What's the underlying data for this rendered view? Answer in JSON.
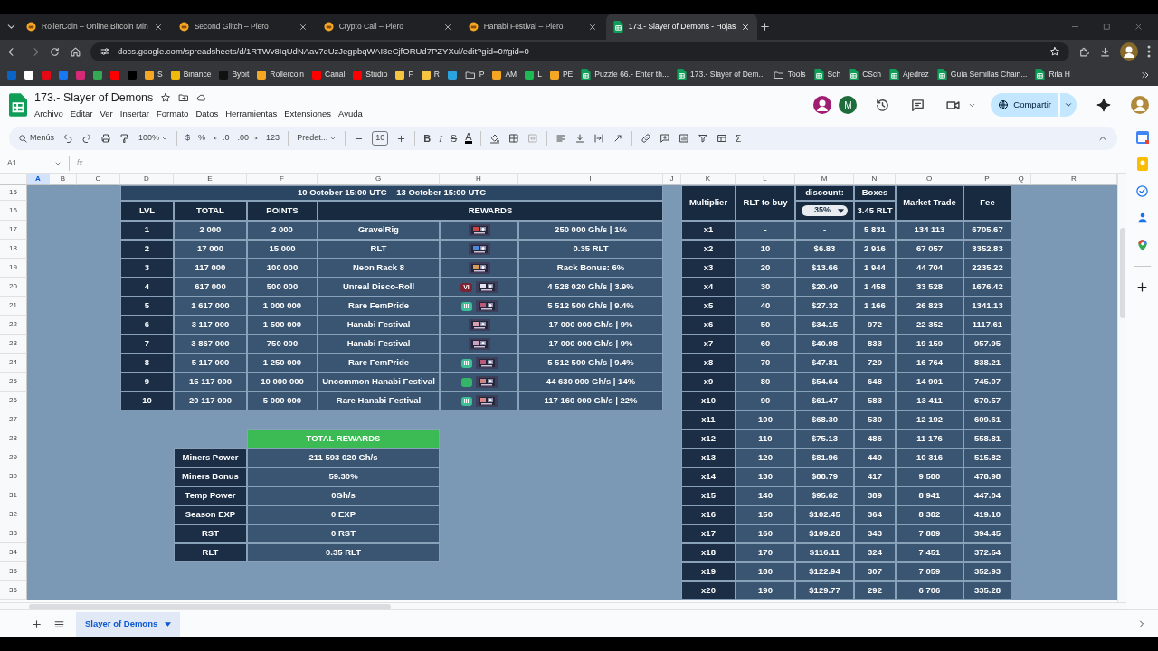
{
  "browser": {
    "tabs": [
      {
        "title": "RollerCoin – Online Bitcoin Min",
        "kind": "site",
        "selected": false
      },
      {
        "title": "Second Glitch – Piero",
        "kind": "site",
        "selected": false
      },
      {
        "title": "Crypto Call – Piero",
        "kind": "site",
        "selected": false
      },
      {
        "title": "Hanabi Festival – Piero",
        "kind": "site",
        "selected": false
      },
      {
        "title": "173.- Slayer of Demons - Hojas",
        "kind": "sheet",
        "selected": true
      }
    ],
    "url": "docs.google.com/spreadsheets/d/1RTWv8IqUdNAav7eUzJegpbqWAI8eCjfORUd7PZYXul/edit?gid=0#gid=0",
    "bookmarks": [
      {
        "kind": "site",
        "color": "#0a64c8"
      },
      {
        "kind": "site",
        "color": "#ffffff"
      },
      {
        "kind": "site",
        "color": "#e50914"
      },
      {
        "kind": "site",
        "color": "#1877f2"
      },
      {
        "kind": "site",
        "color": "#d62976"
      },
      {
        "kind": "site",
        "color": "#34a853"
      },
      {
        "kind": "site",
        "color": "#ff0000"
      },
      {
        "kind": "site",
        "color": "#000000"
      },
      {
        "kind": "site",
        "color": "#f5a623",
        "label": "S"
      },
      {
        "kind": "site",
        "color": "#f0b90b",
        "label": "Binance"
      },
      {
        "kind": "site",
        "color": "#111111",
        "label": "Bybit"
      },
      {
        "kind": "site",
        "color": "#f5a623",
        "label": "Rollercoin"
      },
      {
        "kind": "site",
        "color": "#ff0000",
        "label": "Canal"
      },
      {
        "kind": "site",
        "color": "#ff0000",
        "label": "Studio"
      },
      {
        "kind": "site",
        "color": "#f5c542",
        "label": "F"
      },
      {
        "kind": "site",
        "color": "#f5c542",
        "label": "R"
      },
      {
        "kind": "site",
        "color": "#2aa3df"
      },
      {
        "kind": "folder",
        "label": "P"
      },
      {
        "kind": "site",
        "color": "#f5a623",
        "label": "AM"
      },
      {
        "kind": "site",
        "color": "#1db954",
        "label": "L"
      },
      {
        "kind": "site",
        "color": "#f5a623",
        "label": "PE"
      },
      {
        "kind": "sheet",
        "label": "Puzzle 66.- Enter th..."
      },
      {
        "kind": "sheet",
        "label": "173.- Slayer of Dem..."
      },
      {
        "kind": "folder",
        "label": "Tools"
      },
      {
        "kind": "sheet",
        "label": "Sch"
      },
      {
        "kind": "sheet",
        "label": "CSch"
      },
      {
        "kind": "sheet",
        "label": "Ajedrez"
      },
      {
        "kind": "sheet",
        "label": "Guía Semillas Chain..."
      },
      {
        "kind": "sheet",
        "label": "Rifa H"
      }
    ]
  },
  "sheets": {
    "title": "173.- Slayer of Demons",
    "menus": [
      "Archivo",
      "Editar",
      "Ver",
      "Insertar",
      "Formato",
      "Datos",
      "Herramientas",
      "Extensiones",
      "Ayuda"
    ],
    "avatar": "M",
    "share": "Compartir",
    "search_placeholder": "Menús",
    "zoom": "100%",
    "number_formats": [
      "$",
      "%",
      ".0",
      ".00",
      "123"
    ],
    "font": "Predet...",
    "font_size": "10",
    "styles": [
      {
        "text": "B",
        "kind": "bold"
      },
      {
        "text": "I",
        "kind": "italic"
      },
      {
        "text": "S",
        "kind": "strike"
      },
      {
        "text": "A",
        "kind": "color"
      }
    ],
    "functions": "Σ",
    "cell_ref": "A1",
    "fx": "fx"
  },
  "columns": [
    "A",
    "B",
    "C",
    "D",
    "E",
    "F",
    "G",
    "H",
    "I",
    "J",
    "K",
    "L",
    "M",
    "N",
    "O",
    "P",
    "Q",
    "R"
  ],
  "row_numbers": [
    "15",
    "16",
    "17",
    "18",
    "19",
    "20",
    "21",
    "22",
    "23",
    "24",
    "25",
    "26",
    "27",
    "28",
    "29",
    "30",
    "31",
    "32",
    "33",
    "34",
    "35",
    "36"
  ],
  "event": {
    "banner": "10 October 15:00 UTC – 13 October 15:00 UTC",
    "headers": [
      "LVL",
      "TOTAL",
      "POINTS",
      "REWARDS"
    ],
    "levels": [
      {
        "lvl": "1",
        "total": "2 000",
        "points": "2 000",
        "name": "GravelRig",
        "reward": "250 000 Gh/s | 1%"
      },
      {
        "lvl": "2",
        "total": "17 000",
        "points": "15 000",
        "name": "RLT",
        "reward": "0.35 RLT"
      },
      {
        "lvl": "3",
        "total": "117 000",
        "points": "100 000",
        "name": "Neon Rack 8",
        "reward": "Rack Bonus: 6%"
      },
      {
        "lvl": "4",
        "total": "617 000",
        "points": "500 000",
        "name": "Unreal Disco-Roll",
        "badge": {
          "text": "VI",
          "color": "#7a2433"
        },
        "reward": "4 528 020 Gh/s | 3.9%"
      },
      {
        "lvl": "5",
        "total": "1 617 000",
        "points": "1 000 000",
        "name": "Rare FemPride",
        "badge": {
          "text": "III",
          "color": "#3fbf95"
        },
        "reward": "5 512 500 Gh/s | 9.4%"
      },
      {
        "lvl": "6",
        "total": "3 117 000",
        "points": "1 500 000",
        "name": "Hanabi Festival",
        "reward": "17 000 000 Gh/s | 9%"
      },
      {
        "lvl": "7",
        "total": "3 867 000",
        "points": "750 000",
        "name": "Hanabi Festival",
        "reward": "17 000 000 Gh/s | 9%"
      },
      {
        "lvl": "8",
        "total": "5 117 000",
        "points": "1 250 000",
        "name": "Rare FemPride",
        "badge": {
          "text": "III",
          "color": "#3fbf95"
        },
        "reward": "5 512 500 Gh/s | 9.4%"
      },
      {
        "lvl": "9",
        "total": "15 117 000",
        "points": "10 000 000",
        "name": "Uncommon Hanabi Festival",
        "badge": {
          "color": "#35b56a"
        },
        "reward": "44 630 000 Gh/s | 14%"
      },
      {
        "lvl": "10",
        "total": "20 117 000",
        "points": "5 000 000",
        "name": "Rare Hanabi Festival",
        "badge": {
          "text": "III",
          "color": "#3fbf95"
        },
        "reward": "117 160 000 Gh/s | 22%"
      }
    ]
  },
  "multiplier_table": {
    "headers": [
      "Multiplier",
      "RLT to buy",
      "discount:",
      "Boxes",
      "Market Trade",
      "Fee"
    ],
    "discount": "35%",
    "box_price": "3.45 RLT",
    "rows": [
      [
        "x1",
        "-",
        "-",
        "5 831",
        "134 113",
        "6705.67"
      ],
      [
        "x2",
        "10",
        "$6.83",
        "2 916",
        "67 057",
        "3352.83"
      ],
      [
        "x3",
        "20",
        "$13.66",
        "1 944",
        "44 704",
        "2235.22"
      ],
      [
        "x4",
        "30",
        "$20.49",
        "1 458",
        "33 528",
        "1676.42"
      ],
      [
        "x5",
        "40",
        "$27.32",
        "1 166",
        "26 823",
        "1341.13"
      ],
      [
        "x6",
        "50",
        "$34.15",
        "972",
        "22 352",
        "1117.61"
      ],
      [
        "x7",
        "60",
        "$40.98",
        "833",
        "19 159",
        "957.95"
      ],
      [
        "x8",
        "70",
        "$47.81",
        "729",
        "16 764",
        "838.21"
      ],
      [
        "x9",
        "80",
        "$54.64",
        "648",
        "14 901",
        "745.07"
      ],
      [
        "x10",
        "90",
        "$61.47",
        "583",
        "13 411",
        "670.57"
      ],
      [
        "x11",
        "100",
        "$68.30",
        "530",
        "12 192",
        "609.61"
      ],
      [
        "x12",
        "110",
        "$75.13",
        "486",
        "11 176",
        "558.81"
      ],
      [
        "x13",
        "120",
        "$81.96",
        "449",
        "10 316",
        "515.82"
      ],
      [
        "x14",
        "130",
        "$88.79",
        "417",
        "9 580",
        "478.98"
      ],
      [
        "x15",
        "140",
        "$95.62",
        "389",
        "8 941",
        "447.04"
      ],
      [
        "x16",
        "150",
        "$102.45",
        "364",
        "8 382",
        "419.10"
      ],
      [
        "x17",
        "160",
        "$109.28",
        "343",
        "7 889",
        "394.45"
      ],
      [
        "x18",
        "170",
        "$116.11",
        "324",
        "7 451",
        "372.54"
      ],
      [
        "x19",
        "180",
        "$122.94",
        "307",
        "7 059",
        "352.93"
      ],
      [
        "x20",
        "190",
        "$129.77",
        "292",
        "6 706",
        "335.28"
      ]
    ]
  },
  "totals": {
    "title": "TOTAL REWARDS",
    "rows": [
      {
        "label": "Miners Power",
        "value": "211 593 020 Gh/s"
      },
      {
        "label": "Miners Bonus",
        "value": "59.30%"
      },
      {
        "label": "Temp Power",
        "value": "0Gh/s"
      },
      {
        "label": "Season EXP",
        "value": "0 EXP"
      },
      {
        "label": "RST",
        "value": "0 RST"
      },
      {
        "label": "RLT",
        "value": "0.35 RLT"
      }
    ]
  },
  "sheet_tabs": [
    {
      "label": "Slayer of Demons",
      "selected": true
    }
  ]
}
